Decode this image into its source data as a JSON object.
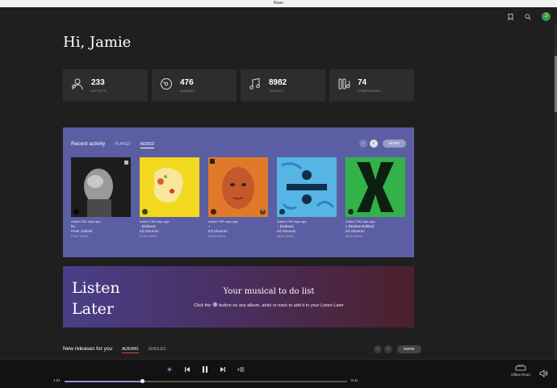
{
  "window": {
    "title": "Roon"
  },
  "header": {
    "avatar_initial": "J",
    "icons": [
      "bookmark-icon",
      "search-icon"
    ]
  },
  "greeting": "Hi, Jamie",
  "stats": [
    {
      "icon": "artists-icon",
      "count": "233",
      "label": "ARTISTS"
    },
    {
      "icon": "album-disc-icon",
      "count": "476",
      "label": "ALBUMS"
    },
    {
      "icon": "music-note-icon",
      "count": "8982",
      "label": "TRACKS"
    },
    {
      "icon": "composers-icon",
      "count": "74",
      "label": "COMPOSERS"
    }
  ],
  "recent": {
    "title": "Recent activity",
    "tabs": [
      "PLAYED",
      "ADDED"
    ],
    "active_tab": "ADDED",
    "more_label": "MORE",
    "albums": [
      {
        "added": "Added 330 days ago",
        "name": "i/o",
        "artist": "Peter Gabriel",
        "format": "FLAC 96/24",
        "color": "#2c2c2c"
      },
      {
        "added": "Added 769 days ago",
        "name": "- (Deluxe)",
        "artist": "Ed Sheeran",
        "format": "FLAC 48/24",
        "color": "#f2d81e"
      },
      {
        "added": "Added 796 days ago",
        "name": "+",
        "artist": "Ed Sheeran",
        "format": "MQA 44kHz",
        "color": "#e07a2a"
      },
      {
        "added": "Added 796 days ago",
        "name": "÷ (Deluxe)",
        "artist": "Ed Sheeran",
        "format": "MQA 44kHz",
        "color": "#3fa7dc"
      },
      {
        "added": "Added 796 days ago",
        "name": "x (Deluxe Edition)",
        "artist": "Ed Sheeran",
        "format": "MQA 44kHz",
        "color": "#2fa845"
      }
    ]
  },
  "listen_later": {
    "big_line1": "Listen",
    "big_line2": "Later",
    "heading": "Your musical to do list",
    "sub_before": "Click the",
    "sub_after": "button on any album, artist or track to add it to your Listen Later"
  },
  "new_releases": {
    "title": "New releases for you",
    "tabs": [
      "ALBUMS",
      "SINGLES"
    ],
    "active_tab": "ALBUMS",
    "more_label": "MORE"
  },
  "player": {
    "elapsed": "1:51",
    "total": "6:41",
    "progress_fraction": 0.277,
    "zone_name": "Office Roon"
  },
  "colors": {
    "accent": "#8b8fd8",
    "recent_bg": "#5b5ea3"
  }
}
